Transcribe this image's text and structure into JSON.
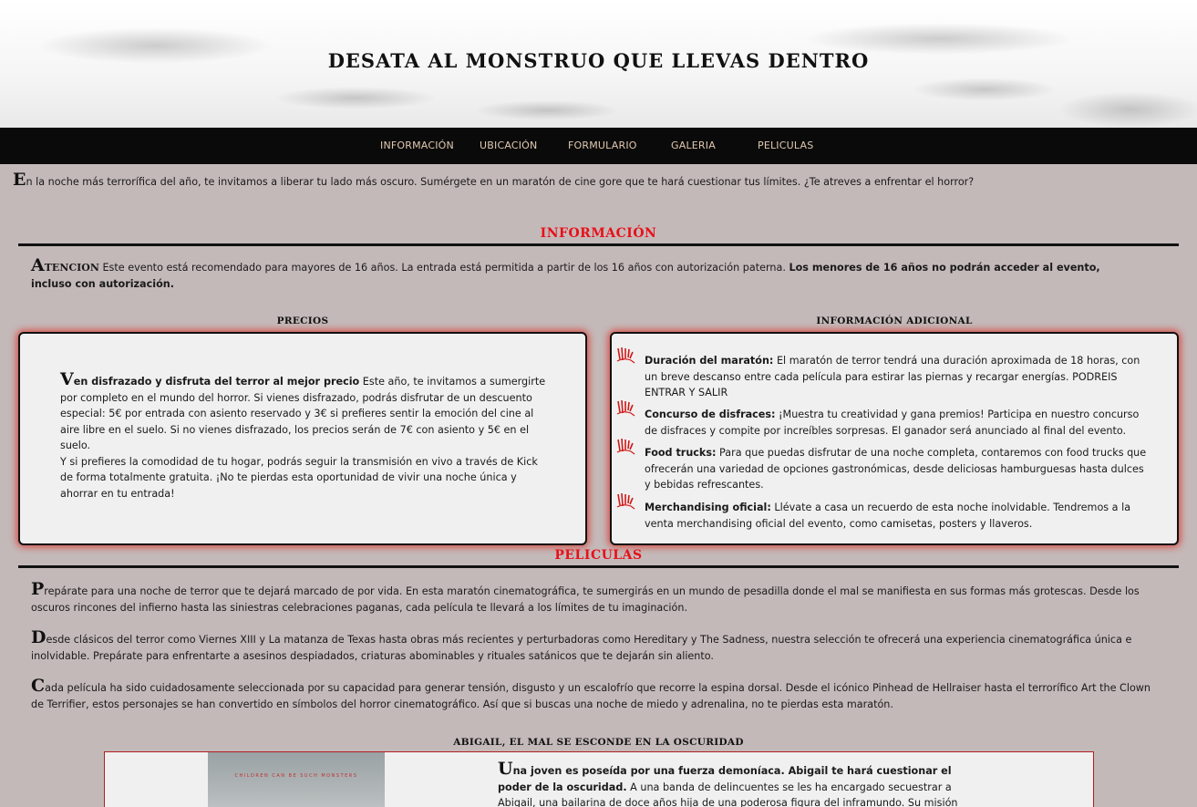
{
  "header": {
    "title": "DESATA AL MONSTRUO QUE LLEVAS DENTRO"
  },
  "nav": {
    "items": [
      "INFORMACIÓN",
      "UBICACIÓN",
      "FORMULARIO",
      "GALERIA",
      "PELICULAS"
    ]
  },
  "intro": {
    "dropcap": "E",
    "text": "n la noche más terrorífica del año, te invitamos a liberar tu lado más oscuro. Sumérgete en un maratón de cine gore que te hará cuestionar tus límites. ¿Te atreves a enfrentar el horror?"
  },
  "informacion": {
    "title": "INFORMACIÓN",
    "atencion_dropcap": "A",
    "atencion_word": "TENCION",
    "atencion_text": " Este evento está recomendado para mayores de 16 años. La entrada está permitida a partir de los 16 años con autorización paterna. ",
    "atencion_bold": "Los menores de 16 años no podrán acceder al evento, incluso con autorización."
  },
  "precios": {
    "title": "PRECIOS",
    "dropcap": "V",
    "lead_bold": "en disfrazado y disfruta del terror al mejor precio",
    "text1": " Este año, te invitamos a sumergirte por completo en el mundo del horror. Si vienes disfrazado, podrás disfrutar de un descuento especial: 5€ por entrada con asiento reservado y 3€ si prefieres sentir la emoción del cine al aire libre en el suelo. Si no vienes disfrazado, los precios serán de 7€ con asiento y 5€ en el suelo.",
    "text2": "Y si prefieres la comodidad de tu hogar, podrás seguir la transmisión en vivo a través de Kick de forma totalmente gratuita. ¡No te pierdas esta oportunidad de vivir una noche única y ahorrar en tu entrada!"
  },
  "adicional": {
    "title": "INFORMACIÓN ADICIONAL",
    "items": [
      {
        "label": "Duración del maratón:",
        "text": " El maratón de terror tendrá una duración aproximada de 18 horas, con un breve descanso entre cada película para estirar las piernas y recargar energías. PODREIS ENTRAR Y SALIR"
      },
      {
        "label": "Concurso de disfraces:",
        "text": " ¡Muestra tu creatividad y gana premios! Participa en nuestro concurso de disfraces y compite por increíbles sorpresas. El ganador será anunciado al final del evento."
      },
      {
        "label": "Food trucks:",
        "text": " Para que puedas disfrutar de una noche completa, contaremos con food trucks que ofrecerán una variedad de opciones gastronómicas, desde deliciosas hamburguesas hasta dulces y bebidas refrescantes."
      },
      {
        "label": "Merchandising oficial:",
        "text": " Llévate a casa un recuerdo de esta noche inolvidable. Tendremos a la venta merchandising oficial del evento, como camisetas, posters y llaveros."
      }
    ]
  },
  "peliculas": {
    "title": "PELICULAS",
    "paragraphs": [
      {
        "dropcap": "P",
        "text": "repárate para una noche de terror que te dejará marcado de por vida. En esta maratón cinematográfica, te sumergirás en un mundo de pesadilla donde el mal se manifiesta en sus formas más grotescas. Desde los oscuros rincones del infierno hasta las siniestras celebraciones paganas, cada película te llevará a los límites de tu imaginación."
      },
      {
        "dropcap": "D",
        "text": "esde clásicos del terror como Viernes XIII y La matanza de Texas hasta obras más recientes y perturbadoras como Hereditary y The Sadness, nuestra selección te ofrecerá una experiencia cinematográfica única e inolvidable. Prepárate para enfrentarte a asesinos despiadados, criaturas abominables y rituales satánicos que te dejarán sin aliento."
      },
      {
        "dropcap": "C",
        "text": "ada película ha sido cuidadosamente seleccionada por su capacidad para generar tensión, disgusto y un escalofrío que recorre la espina dorsal. Desde el icónico Pinhead de Hellraiser hasta el terrorífico Art the Clown de Terrifier, estos personajes se han convertido en símbolos del horror cinematográfico. Así que si buscas una noche de miedo y adrenalina, no te pierdas esta maratón."
      }
    ]
  },
  "movie": {
    "title": "ABIGAIL, EL MAL SE ESCONDE EN LA OSCURIDAD",
    "poster_text": "CHILDREN CAN BE SUCH MONSTERS",
    "dropcap": "U",
    "lead_bold": "na joven es poseída por una fuerza demoníaca. Abigail te hará cuestionar el poder de la oscuridad.",
    "text": " A una banda de delincuentes se les ha encargado secuestrar a Abigail, una bailarina de doce años hija de una poderosa figura del inframundo. Su misión requiere"
  },
  "colors": {
    "background": "#c4b9b9",
    "accent_red": "#e8101a",
    "nav_bg": "#0a0a0a",
    "nav_text": "#e0c9b0"
  }
}
